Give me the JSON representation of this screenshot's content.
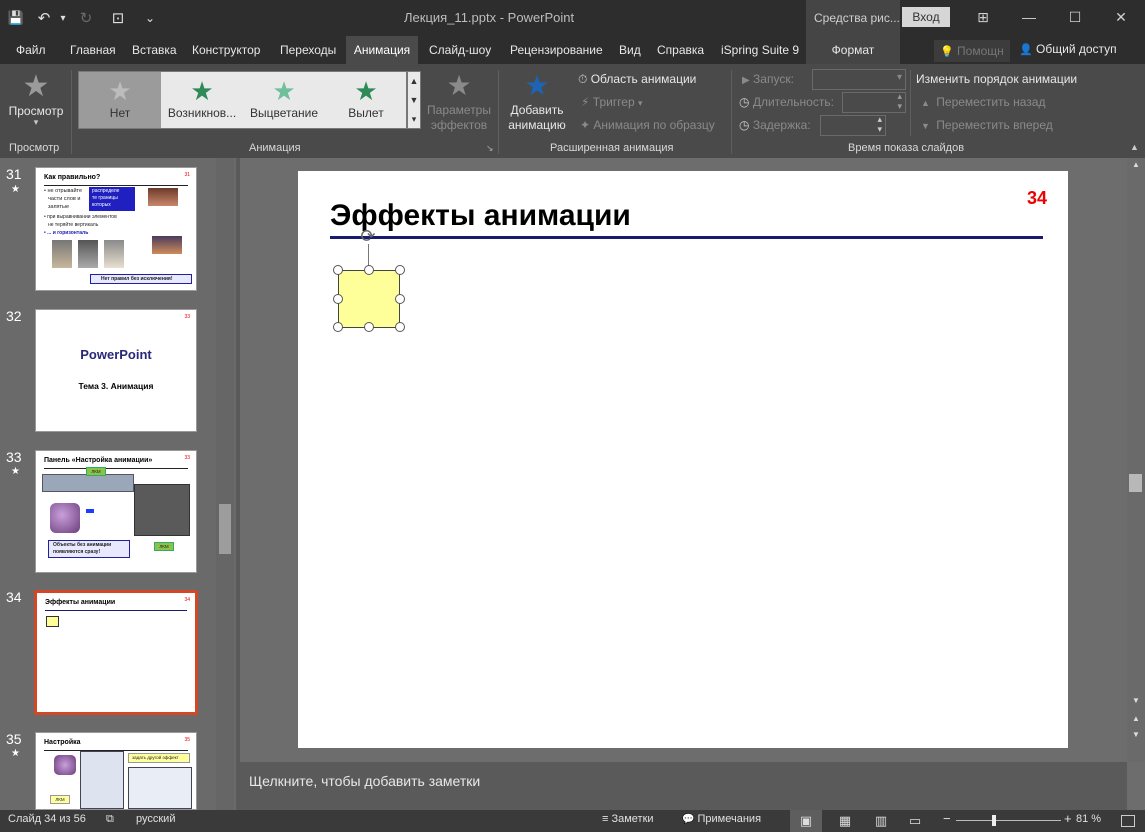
{
  "window": {
    "doc_title": "Лекция_11.pptx  -  PowerPoint",
    "context_tools": "Средства рис...",
    "signin": "Вход"
  },
  "icons": {
    "save": "💾",
    "undo": "↶",
    "undo_arrow": "▾",
    "redo": "↻",
    "start": "⊡",
    "customize": "⌄",
    "ribbon_display": "⊞",
    "minimize": "—",
    "maximize": "☐",
    "close": "✕",
    "lightbulb": "💡",
    "person": "👤",
    "star": "★",
    "anim_pane": "⏱",
    "trigger": "⚡",
    "painter": "✦",
    "clock": "◷",
    "play": "▶",
    "up": "▲",
    "down": "▼",
    "launcher": "↘",
    "spin_up": "▴",
    "spin_down": "▾",
    "dropdown": "▾",
    "rotate": "⟳",
    "notes_icon": "≡",
    "comments_icon": "💬",
    "view_normal": "▣",
    "view_sorter": "▦",
    "view_reading": "▥",
    "view_show": "▭",
    "accessibility": "⧉"
  },
  "tabs": [
    "Файл",
    "Главная",
    "Вставка",
    "Конструктор",
    "Переходы",
    "Анимация",
    "Слайд-шоу",
    "Рецензирование",
    "Вид",
    "Справка",
    "iSpring Suite 9",
    "Формат"
  ],
  "help_search": "Помощн",
  "share": "Общий доступ",
  "ribbon": {
    "preview": {
      "label": "Просмотр",
      "group": "Просмотр"
    },
    "animation_gallery": [
      {
        "label": "Нет",
        "color": "#9a9a9a"
      },
      {
        "label": "Возникнов...",
        "color": "#2e8b57"
      },
      {
        "label": "Выцветание",
        "color": "#6fbf9a"
      },
      {
        "label": "Вылет",
        "color": "#2e8b57"
      }
    ],
    "effect_options": {
      "line1": "Параметры",
      "line2": "эффектов"
    },
    "animation_group": "Анимация",
    "advanced": {
      "add_line1": "Добавить",
      "add_line2": "анимацию",
      "pane": "Область анимации",
      "trigger": "Триггер",
      "painter": "Анимация по образцу",
      "group": "Расширенная анимация"
    },
    "timing": {
      "start": "Запуск:",
      "duration": "Длительность:",
      "delay": "Задержка:",
      "reorder": "Изменить порядок анимации",
      "move_earlier": "Переместить назад",
      "move_later": "Переместить вперед",
      "group": "Время показа слайдов"
    }
  },
  "thumbnails": [
    {
      "num": "31",
      "star": "★",
      "title": "Как правильно?",
      "page": "31",
      "lines": [
        "• не отрывайте",
        "части слов и",
        "запятые",
        "• при выравнивании элементов",
        "не теряйте вертикаль",
        "• ... и горизонталь"
      ],
      "callout": [
        "распределе",
        "те границы",
        "которых"
      ],
      "note": "Нет правил без исключения!"
    },
    {
      "num": "32",
      "title": "PowerPoint",
      "subtitle": "Тема 3. Анимация",
      "page": "33"
    },
    {
      "num": "33",
      "star": "★",
      "title": "Панель «Настройка анимации»",
      "page": "33",
      "lmk": "ЛКМ",
      "note": [
        "Объекты без анимации",
        "появляются сразу!"
      ]
    },
    {
      "num": "34",
      "title": "Эффекты анимации",
      "page": "34"
    },
    {
      "num": "35",
      "star": "★",
      "title": "Настройка",
      "page": "35",
      "callout": "задать другой эффект",
      "lmk": "ЛКМ"
    }
  ],
  "slide": {
    "title": "Эффекты анимации",
    "number": "34"
  },
  "notes_placeholder": "Щелкните, чтобы добавить заметки",
  "status": {
    "slide_info": "Слайд 34 из 56",
    "language": "русский",
    "notes": "Заметки",
    "comments": "Примечания",
    "zoom_minus": "−",
    "zoom_plus": "+",
    "zoom": "81 %"
  }
}
